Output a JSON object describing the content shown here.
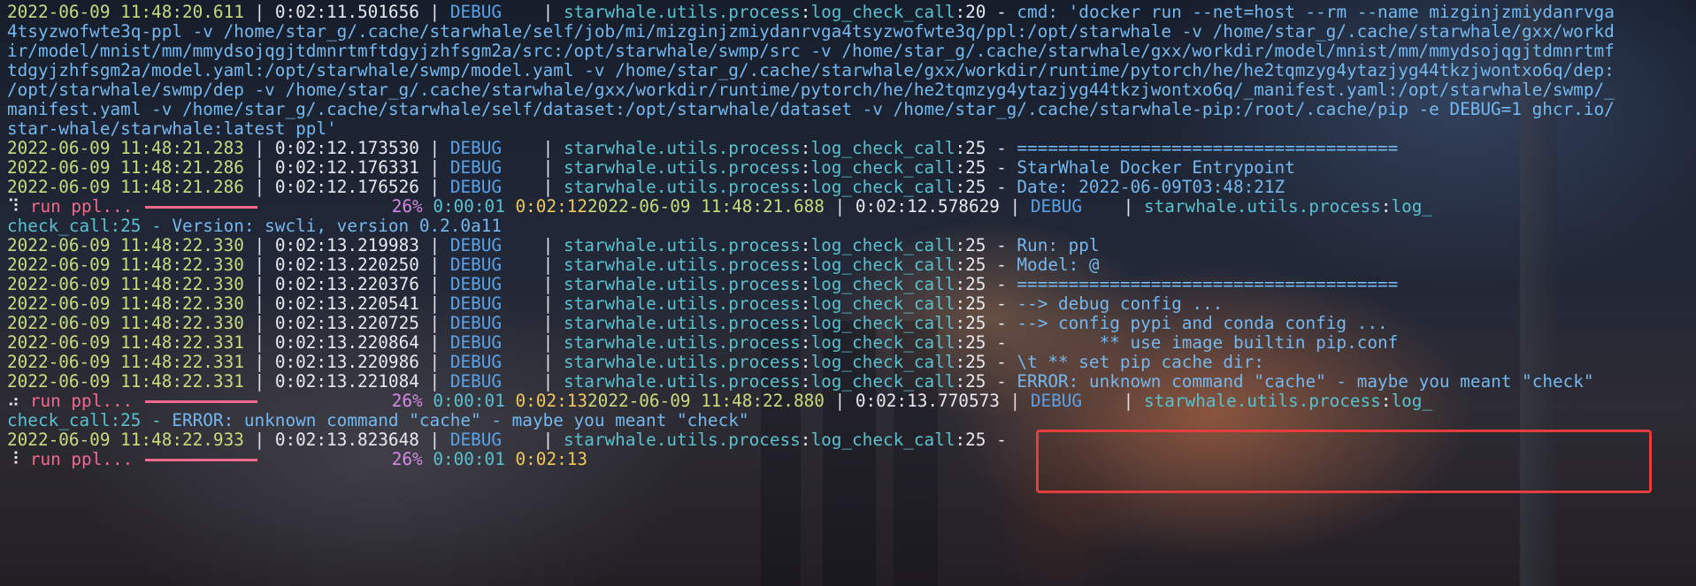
{
  "terminal": {
    "cmd_text": [
      "'docker run --net=host --rm --name mizginjzmiydanrvga",
      "4tsyzwofwte3q-ppl -v /home/star_g/.cache/starwhale/self/job/mi/mizginjzmiydanrvga4tsyzwofwte3q/ppl:/opt/starwhale -v /home/star_g/.cache/starwhale/gxx/workd",
      "ir/model/mnist/mm/mmydsojqgjtdmnrtmftdgyjzhfsgm2a/src:/opt/starwhale/swmp/src -v /home/star_g/.cache/starwhale/gxx/workdir/model/mnist/mm/mmydsojqgjtdmnrtmf",
      "tdgyjzhfsgm2a/model.yaml:/opt/starwhale/swmp/model.yaml -v /home/star_g/.cache/starwhale/gxx/workdir/runtime/pytorch/he/he2tqmzyg4ytazjyg44tkzjwontxo6q/dep:",
      "/opt/starwhale/swmp/dep -v /home/star_g/.cache/starwhale/gxx/workdir/runtime/pytorch/he/he2tqmzyg4ytazjyg44tkzjwontxo6q/_manifest.yaml:/opt/starwhale/swmp/_",
      "manifest.yaml -v /home/star_g/.cache/starwhale/self/dataset:/opt/starwhale/dataset -v /home/star_g/.cache/starwhale-pip:/root/.cache/pip -e DEBUG=1 ghcr.io/",
      "star-whale/starwhale:latest ppl'"
    ],
    "logs": [
      {
        "ts": "2022-06-09 11:48:20.611",
        "el": "0:02:11.501656",
        "level": "DEBUG",
        "module": "starwhale.utils.process",
        "func": "log_check_call",
        "line": "20",
        "msg": "cmd:"
      },
      {
        "ts": "2022-06-09 11:48:21.283",
        "el": "0:02:12.173530",
        "level": "DEBUG",
        "module": "starwhale.utils.process",
        "func": "log_check_call",
        "line": "25",
        "msg": "====================================="
      },
      {
        "ts": "2022-06-09 11:48:21.286",
        "el": "0:02:12.176331",
        "level": "DEBUG",
        "module": "starwhale.utils.process",
        "func": "log_check_call",
        "line": "25",
        "msg": "StarWhale Docker Entrypoint"
      },
      {
        "ts": "2022-06-09 11:48:21.286",
        "el": "0:02:12.176526",
        "level": "DEBUG",
        "module": "starwhale.utils.process",
        "func": "log_check_call",
        "line": "25",
        "msg": "Date: 2022-06-09T03:48:21Z"
      },
      {
        "ts": "2022-06-09 11:48:22.330",
        "el": "0:02:13.219983",
        "level": "DEBUG",
        "module": "starwhale.utils.process",
        "func": "log_check_call",
        "line": "25",
        "msg": "Run: ppl"
      },
      {
        "ts": "2022-06-09 11:48:22.330",
        "el": "0:02:13.220250",
        "level": "DEBUG",
        "module": "starwhale.utils.process",
        "func": "log_check_call",
        "line": "25",
        "msg": "Model: @"
      },
      {
        "ts": "2022-06-09 11:48:22.330",
        "el": "0:02:13.220376",
        "level": "DEBUG",
        "module": "starwhale.utils.process",
        "func": "log_check_call",
        "line": "25",
        "msg": "====================================="
      },
      {
        "ts": "2022-06-09 11:48:22.330",
        "el": "0:02:13.220541",
        "level": "DEBUG",
        "module": "starwhale.utils.process",
        "func": "log_check_call",
        "line": "25",
        "msg": "--> debug config ..."
      },
      {
        "ts": "2022-06-09 11:48:22.330",
        "el": "0:02:13.220725",
        "level": "DEBUG",
        "module": "starwhale.utils.process",
        "func": "log_check_call",
        "line": "25",
        "msg": "--> config pypi and conda config ..."
      },
      {
        "ts": "2022-06-09 11:48:22.331",
        "el": "0:02:13.220864",
        "level": "DEBUG",
        "module": "starwhale.utils.process",
        "func": "log_check_call",
        "line": "25",
        "msg": "        ** use image builtin pip.conf"
      },
      {
        "ts": "2022-06-09 11:48:22.331",
        "el": "0:02:13.220986",
        "level": "DEBUG",
        "module": "starwhale.utils.process",
        "func": "log_check_call",
        "line": "25",
        "msg": "\\t ** set pip cache dir:"
      },
      {
        "ts": "2022-06-09 11:48:22.331",
        "el": "0:02:13.221084",
        "level": "DEBUG",
        "module": "starwhale.utils.process",
        "func": "log_check_call",
        "line": "25",
        "msg": "ERROR: unknown command \"cache\" - maybe you meant \"check\""
      },
      {
        "ts": "2022-06-09 11:48:22.933",
        "el": "0:02:13.823648",
        "level": "DEBUG",
        "module": "starwhale.utils.process",
        "func": "log_check_call",
        "line": "25",
        "msg": ""
      }
    ],
    "progress": [
      {
        "spinner": "⠹",
        "label": "run ppl...",
        "percent": "26%",
        "elapsed": "0:00:01",
        "total": "0:02:12",
        "tail_ts": "2022-06-09 11:48:21.688",
        "tail_el": "0:02:12.578629",
        "tail_level": "DEBUG",
        "tail_module": "starwhale.utils.process",
        "tail_func": "log_",
        "wrap_text": "check_call:25 - ",
        "wrap_msg": "Version: swcli, version 0.2.0a11"
      },
      {
        "spinner": "⠴",
        "label": "run ppl...",
        "percent": "26%",
        "elapsed": "0:00:01",
        "total": "0:02:13",
        "tail_ts": "2022-06-09 11:48:22.880",
        "tail_el": "0:02:13.770573",
        "tail_level": "DEBUG",
        "tail_module": "starwhale.utils.process",
        "tail_func": "log_",
        "wrap_text": "check_call:25 - ",
        "wrap_msg": "ERROR: unknown command \"cache\" - maybe you meant \"check\""
      },
      {
        "spinner": "⠸",
        "label": "run ppl...",
        "percent": "26%",
        "elapsed": "0:00:01",
        "total": "0:02:13"
      }
    ],
    "colors": {
      "timestamp": "#c7dc7d",
      "level": "#5aa2e8",
      "module": "#59c1cf",
      "message": "#74b8ef",
      "progress_label": "#f06a8c",
      "percent": "#d78ae6",
      "total_time": "#f0c85a",
      "highlight_box": "#e43d3d"
    }
  }
}
